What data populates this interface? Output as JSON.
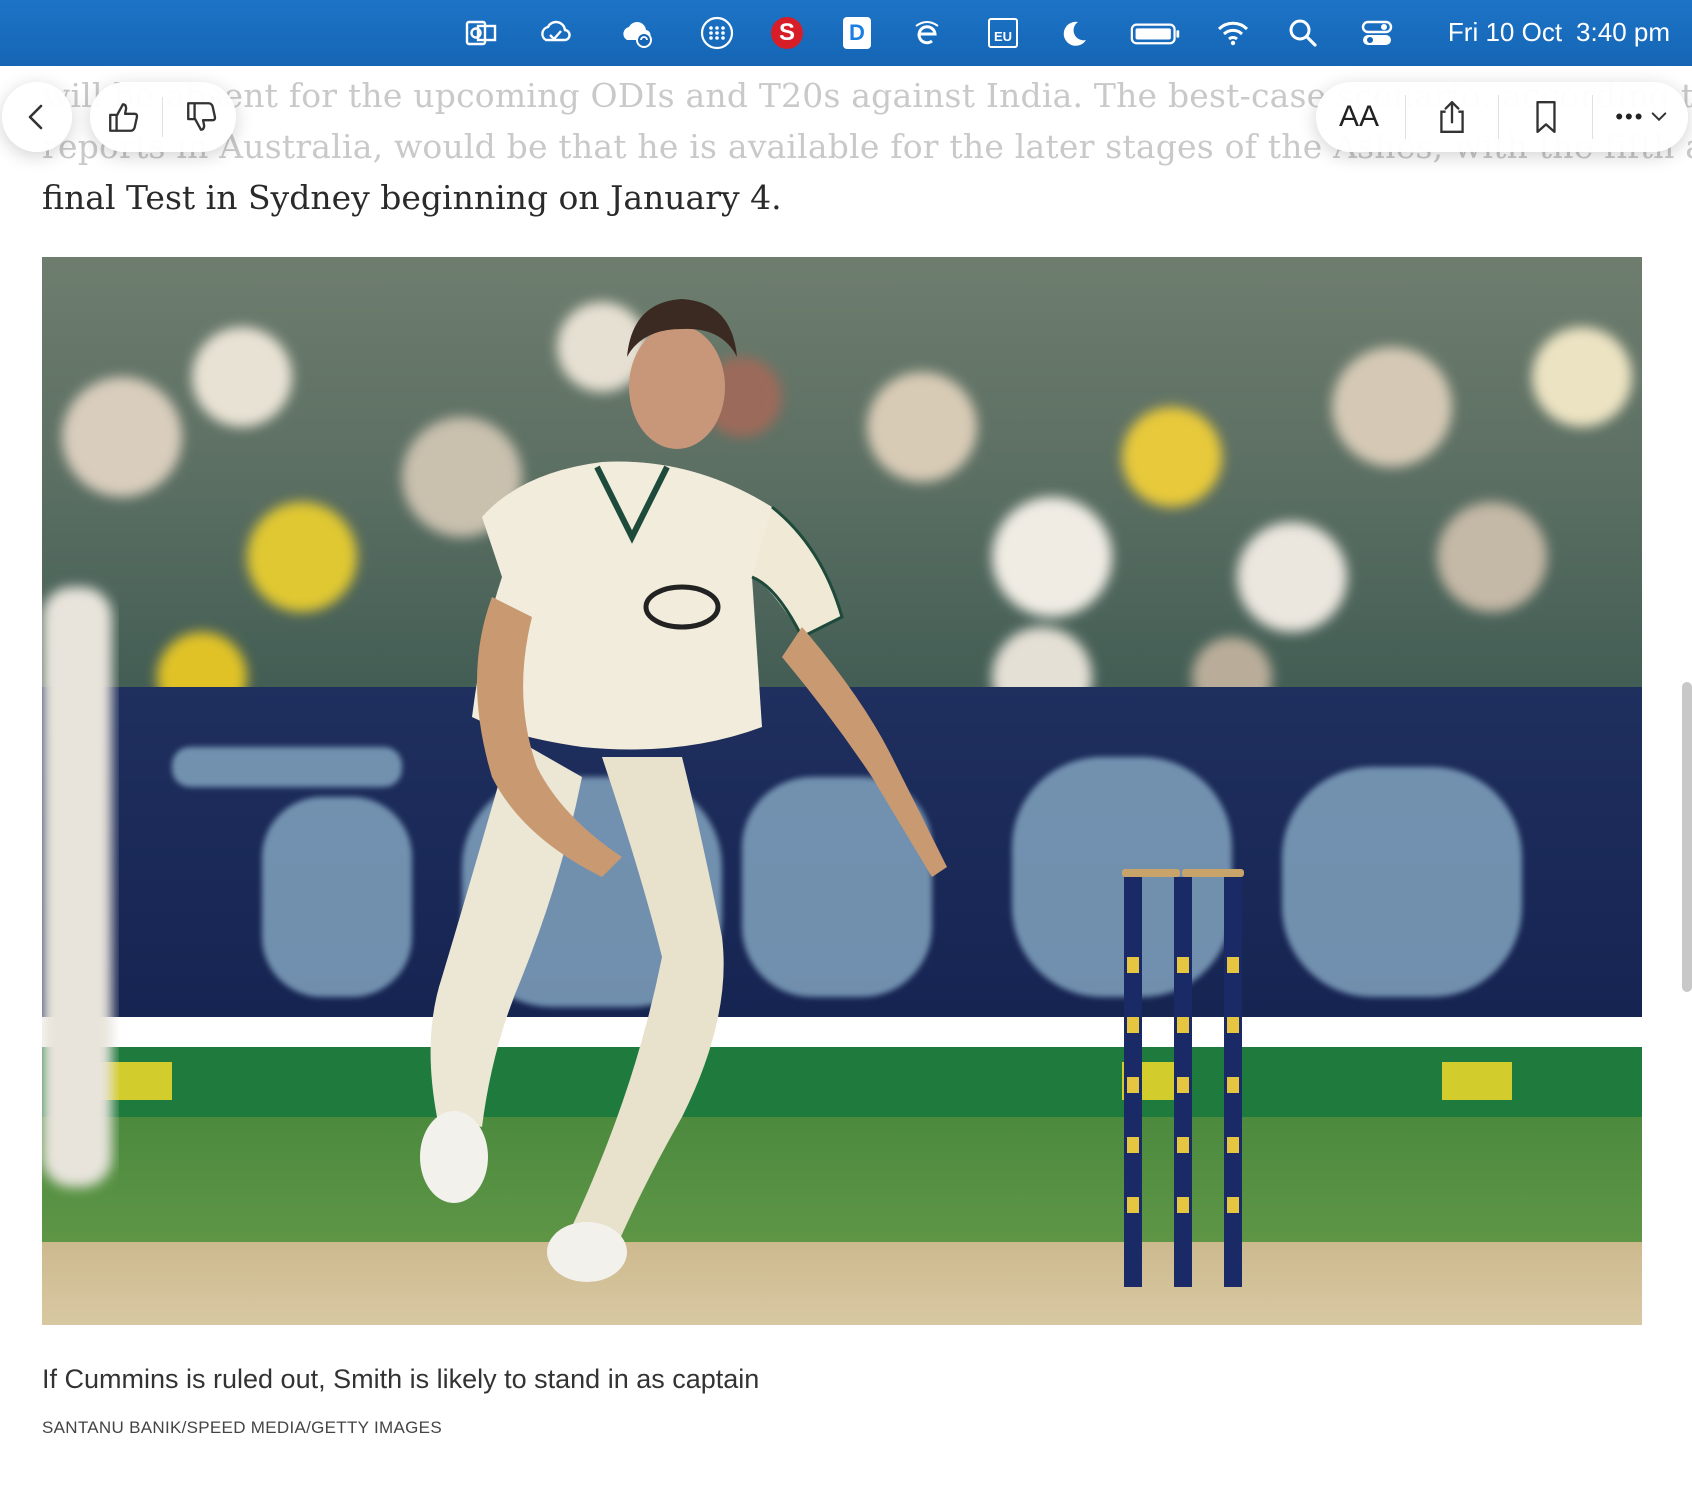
{
  "menubar": {
    "icons": [
      "outlook-icon",
      "cloud-sync-icon",
      "icloud-icon",
      "dots-grid-icon",
      "s-app-icon",
      "d-app-icon",
      "browser-e-icon",
      "eu-icon",
      "moon-icon",
      "battery-icon",
      "wifi-icon",
      "search-icon",
      "control-center-icon"
    ],
    "s_label": "S",
    "d_label": "D",
    "eu_label": "EU",
    "date": "Fri 10 Oct",
    "time": "3:40 pm"
  },
  "article": {
    "faded_line_1": "will be absent for the upcoming ODIs and T20s against India. The best-case scenario, according to",
    "faded_line_2": "reports in Australia, would be that he is available for the later stages of the Ashes, with the fifth and",
    "last_line": "final Test in Sydney beginning on January 4.",
    "caption": "If Cummins is ruled out, Smith is likely to stand in as captain",
    "credit": "SANTANU BANIK/SPEED MEDIA/GETTY IMAGES"
  },
  "toolbar": {
    "text_size_label": "AA",
    "more_label": "•••"
  },
  "colors": {
    "menubar": "#1565b4",
    "body_text": "#2a2a2a",
    "faded_text": "#c9c9c9",
    "stump_blue": "#1a2a66"
  }
}
